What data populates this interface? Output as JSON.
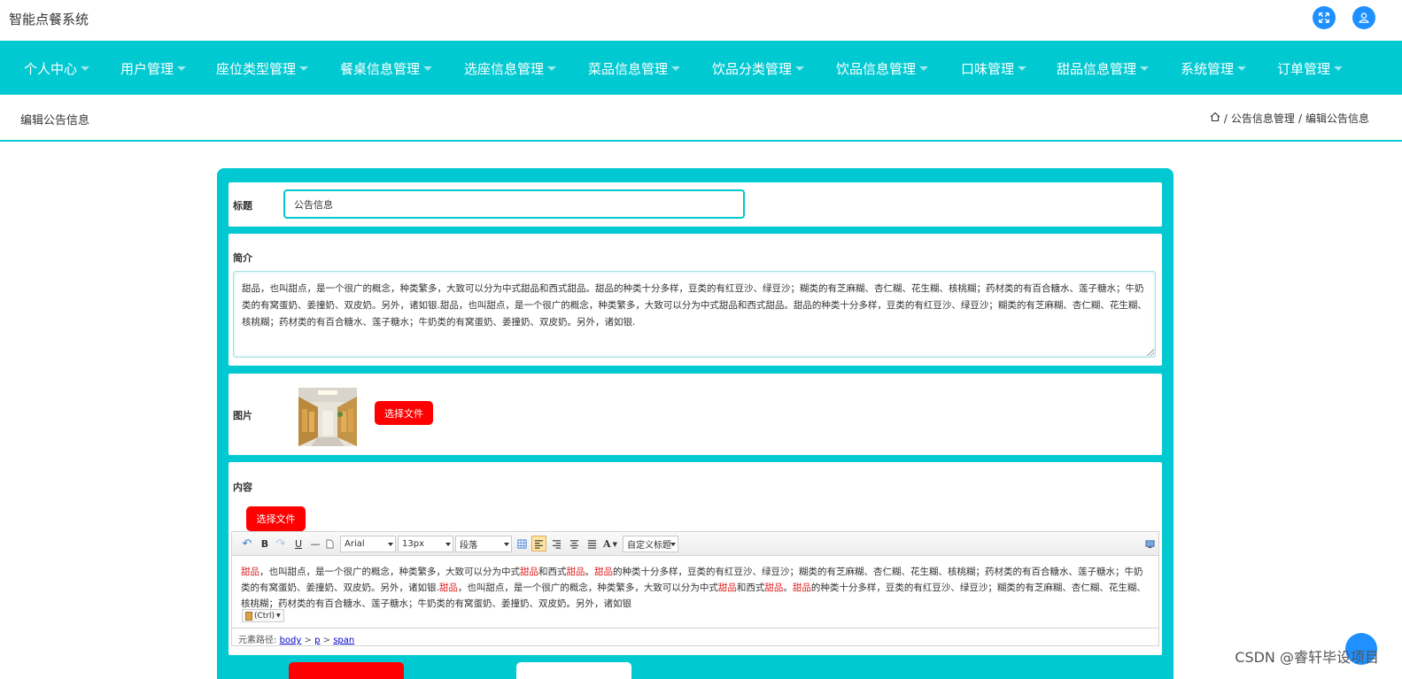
{
  "header": {
    "app_title": "智能点餐系统",
    "icons": [
      "expand-icon",
      "user-icon"
    ],
    "accent_color": "#1e90ff"
  },
  "nav": {
    "background": "#00c9d2",
    "items": [
      {
        "label": "个人中心"
      },
      {
        "label": "用户管理"
      },
      {
        "label": "座位类型管理"
      },
      {
        "label": "餐桌信息管理"
      },
      {
        "label": "选座信息管理"
      },
      {
        "label": "菜品信息管理"
      },
      {
        "label": "饮品分类管理"
      },
      {
        "label": "饮品信息管理"
      },
      {
        "label": "口味管理"
      },
      {
        "label": "甜品信息管理"
      },
      {
        "label": "系统管理"
      },
      {
        "label": "订单管理"
      }
    ]
  },
  "page": {
    "title": "编辑公告信息",
    "breadcrumb": [
      "公告信息管理",
      "编辑公告信息"
    ],
    "separator": "/"
  },
  "form": {
    "title_label": "标题",
    "title_value": "公告信息",
    "summary_label": "简介",
    "summary_value": "甜品，也叫甜点，是一个很广的概念，种类繁多，大致可以分为中式甜品和西式甜品。甜品的种类十分多样，豆类的有红豆沙、绿豆沙；糊类的有芝麻糊、杏仁糊、花生糊、核桃糊；药材类的有百合糖水、莲子糖水；牛奶类的有窝蛋奶、姜撞奶、双皮奶。另外，诸如银.甜品，也叫甜点，是一个很广的概念，种类繁多，大致可以分为中式甜品和西式甜品。甜品的种类十分多样，豆类的有红豆沙、绿豆沙；糊类的有芝麻糊、杏仁糊、花生糊、核桃糊；药材类的有百合糖水、莲子糖水；牛奶类的有窝蛋奶、姜撞奶、双皮奶。另外，诸如银.",
    "image_label": "图片",
    "choose_file_label": "选择文件",
    "content_label": "内容",
    "content_choose_file_label": "选择文件"
  },
  "editor": {
    "font_family": "Arial",
    "font_size": "13px",
    "paragraph": "段落",
    "custom_title": "自定义标题",
    "font_color_glyph": "A",
    "paste_hint": "(Ctrl)",
    "element_path_label": "元素路径:",
    "element_path": [
      "body",
      "p",
      "span"
    ],
    "path_separator": ">",
    "content_segments": [
      {
        "text": "甜品",
        "hl": true
      },
      {
        "text": "，也叫甜点，是一个很广的概念，种类繁多，大致可以分为中式",
        "hl": false
      },
      {
        "text": "甜品",
        "hl": true
      },
      {
        "text": "和西式",
        "hl": false
      },
      {
        "text": "甜品",
        "hl": true
      },
      {
        "text": "。",
        "hl": false
      },
      {
        "text": "甜品",
        "hl": true
      },
      {
        "text": "的种类十分多样，豆类的有红豆沙、绿豆沙；糊类的有芝麻糊、杏仁糊、花生糊、核桃糊；药材类的有百合糖水、莲子糖水；牛奶类的有窝蛋奶、姜撞奶、双皮奶。另外，诸如银.",
        "hl": false
      },
      {
        "text": "甜品",
        "hl": true
      },
      {
        "text": "，也叫甜点，是一个很广的概念，种类繁多，大致可以分为中式",
        "hl": false
      },
      {
        "text": "甜品",
        "hl": true
      },
      {
        "text": "和西式",
        "hl": false
      },
      {
        "text": "甜品",
        "hl": true
      },
      {
        "text": "。",
        "hl": false
      },
      {
        "text": "甜品",
        "hl": true
      },
      {
        "text": "的种类十分多样，豆类的有红豆沙、绿豆沙；糊类的有芝麻糊、杏仁糊、花生糊、核桃糊；药材类的有百合糖水、莲子糖水；牛奶类的有窝蛋奶、姜撞奶、双皮奶。另外，诸如银",
        "hl": false
      }
    ]
  },
  "watermark": "CSDN @睿轩毕设项目"
}
